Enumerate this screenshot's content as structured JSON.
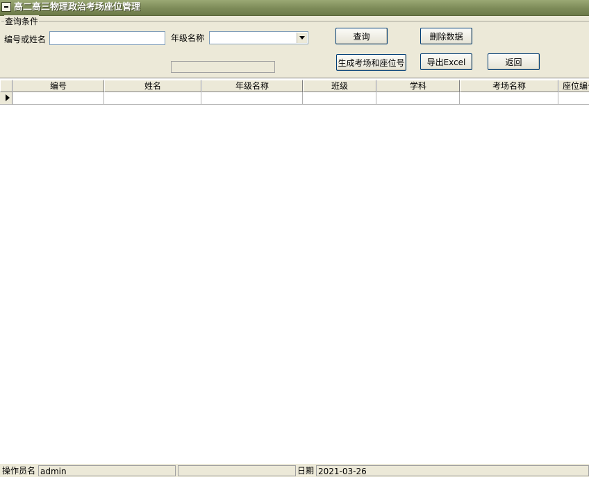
{
  "window": {
    "title": "高二高三物理政治考场座位管理"
  },
  "query": {
    "group_label": "查询条件",
    "id_or_name_label": "编号或姓名",
    "id_or_name_value": "",
    "grade_label": "年级名称",
    "grade_value": "",
    "search_button": "查询",
    "delete_button": "删除数据",
    "generate_button": "生成考场和座位号",
    "export_button": "导出Excel",
    "back_button": "返回"
  },
  "grid": {
    "columns": [
      "编号",
      "姓名",
      "年级名称",
      "班级",
      "学科",
      "考场名称",
      "座位编号"
    ],
    "rows": [
      [
        "",
        "",
        "",
        "",
        "",
        "",
        ""
      ]
    ]
  },
  "status": {
    "operator_label": "操作员名",
    "operator_value": "admin",
    "date_label": "日期",
    "date_value": "2021-03-26"
  }
}
